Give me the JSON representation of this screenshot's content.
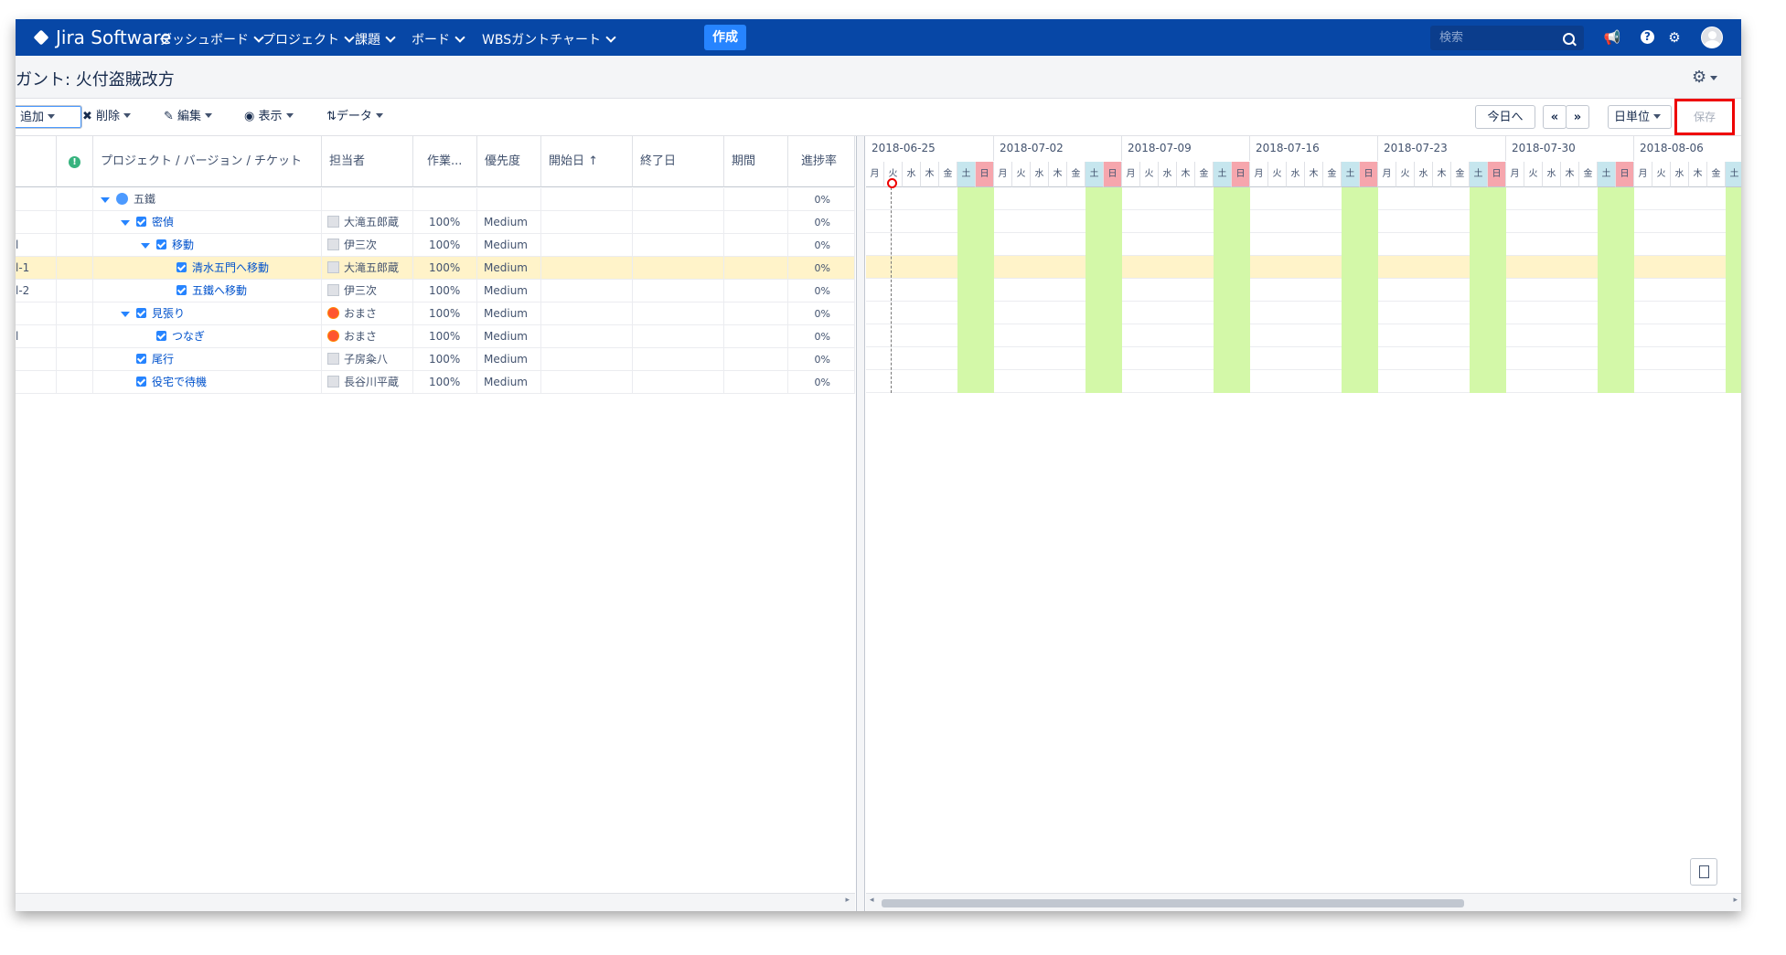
{
  "nav": {
    "logo": "Jira Software",
    "items": [
      "ダッシュボード",
      "プロジェクト",
      "課題",
      "ボード",
      "WBSガントチャート"
    ],
    "create": "作成",
    "search_placeholder": "検索"
  },
  "page": {
    "title": "ガント: 火付盗賊改方"
  },
  "toolbar": {
    "add": "追加",
    "delete": "削除",
    "edit": "編集",
    "view": "表示",
    "data": "データ",
    "today": "今日へ",
    "prev": "«",
    "next": "»",
    "unit": "日単位",
    "save": "保存"
  },
  "columns": [
    "プロジェクト / バージョン / チケット",
    "担当者",
    "作業...",
    "優先度",
    "開始日 ↑",
    "終了日",
    "期間",
    "進捗率"
  ],
  "rows": [
    {
      "key": "",
      "name": "五鐵",
      "level": 0,
      "type": "project",
      "assignee": "",
      "work": "",
      "priority": "",
      "progress": "0%",
      "selected": false
    },
    {
      "key": "",
      "name": "密偵",
      "level": 1,
      "type": "task",
      "expand": true,
      "assignee": "大滝五郎蔵",
      "avatar": "plain",
      "work": "100%",
      "priority": "Medium",
      "progress": "0%",
      "selected": false
    },
    {
      "key": "l",
      "name": "移動",
      "level": 2,
      "type": "task",
      "expand": true,
      "assignee": "伊三次",
      "avatar": "plain",
      "work": "100%",
      "priority": "Medium",
      "progress": "0%",
      "selected": false
    },
    {
      "key": "l-1",
      "name": "清水五門へ移動",
      "level": 3,
      "type": "task",
      "assignee": "大滝五郎蔵",
      "avatar": "plain",
      "work": "100%",
      "priority": "Medium",
      "progress": "0%",
      "selected": true
    },
    {
      "key": "l-2",
      "name": "五鐵へ移動",
      "level": 3,
      "type": "task",
      "assignee": "伊三次",
      "avatar": "plain",
      "work": "100%",
      "priority": "Medium",
      "progress": "0%",
      "selected": false
    },
    {
      "key": "",
      "name": "見張り",
      "level": 1,
      "type": "task",
      "expand": true,
      "assignee": "おまさ",
      "avatar": "fire",
      "work": "100%",
      "priority": "Medium",
      "progress": "0%",
      "selected": false
    },
    {
      "key": "l",
      "name": "つなぎ",
      "level": 2,
      "type": "task",
      "assignee": "おまさ",
      "avatar": "fire",
      "work": "100%",
      "priority": "Medium",
      "progress": "0%",
      "selected": false
    },
    {
      "key": "",
      "name": "尾行",
      "level": 1,
      "type": "task",
      "assignee": "子房粂八",
      "avatar": "plain",
      "work": "100%",
      "priority": "Medium",
      "progress": "0%",
      "selected": false
    },
    {
      "key": "",
      "name": "役宅で待機",
      "level": 1,
      "type": "task",
      "assignee": "長谷川平蔵",
      "avatar": "plain",
      "work": "100%",
      "priority": "Medium",
      "progress": "0%",
      "selected": false
    }
  ],
  "gantt": {
    "weeks": [
      "2018-06-25",
      "2018-07-02",
      "2018-07-09",
      "2018-07-16",
      "2018-07-23",
      "2018-07-30",
      "2018-08-06"
    ],
    "day_names": [
      "月",
      "火",
      "水",
      "木",
      "金",
      "土",
      "日"
    ],
    "today_day_index": 1,
    "weekend_colors": {
      "sat_header": "#c6e6ee",
      "sun_header": "#f6a6ad",
      "weekend_body": "#d3f8a8"
    }
  },
  "colors": {
    "nav": "#0747a6",
    "accent": "#2684ff",
    "link": "#0052cc",
    "selected_row": "#fff3c9",
    "save_highlight": "#e00000"
  }
}
